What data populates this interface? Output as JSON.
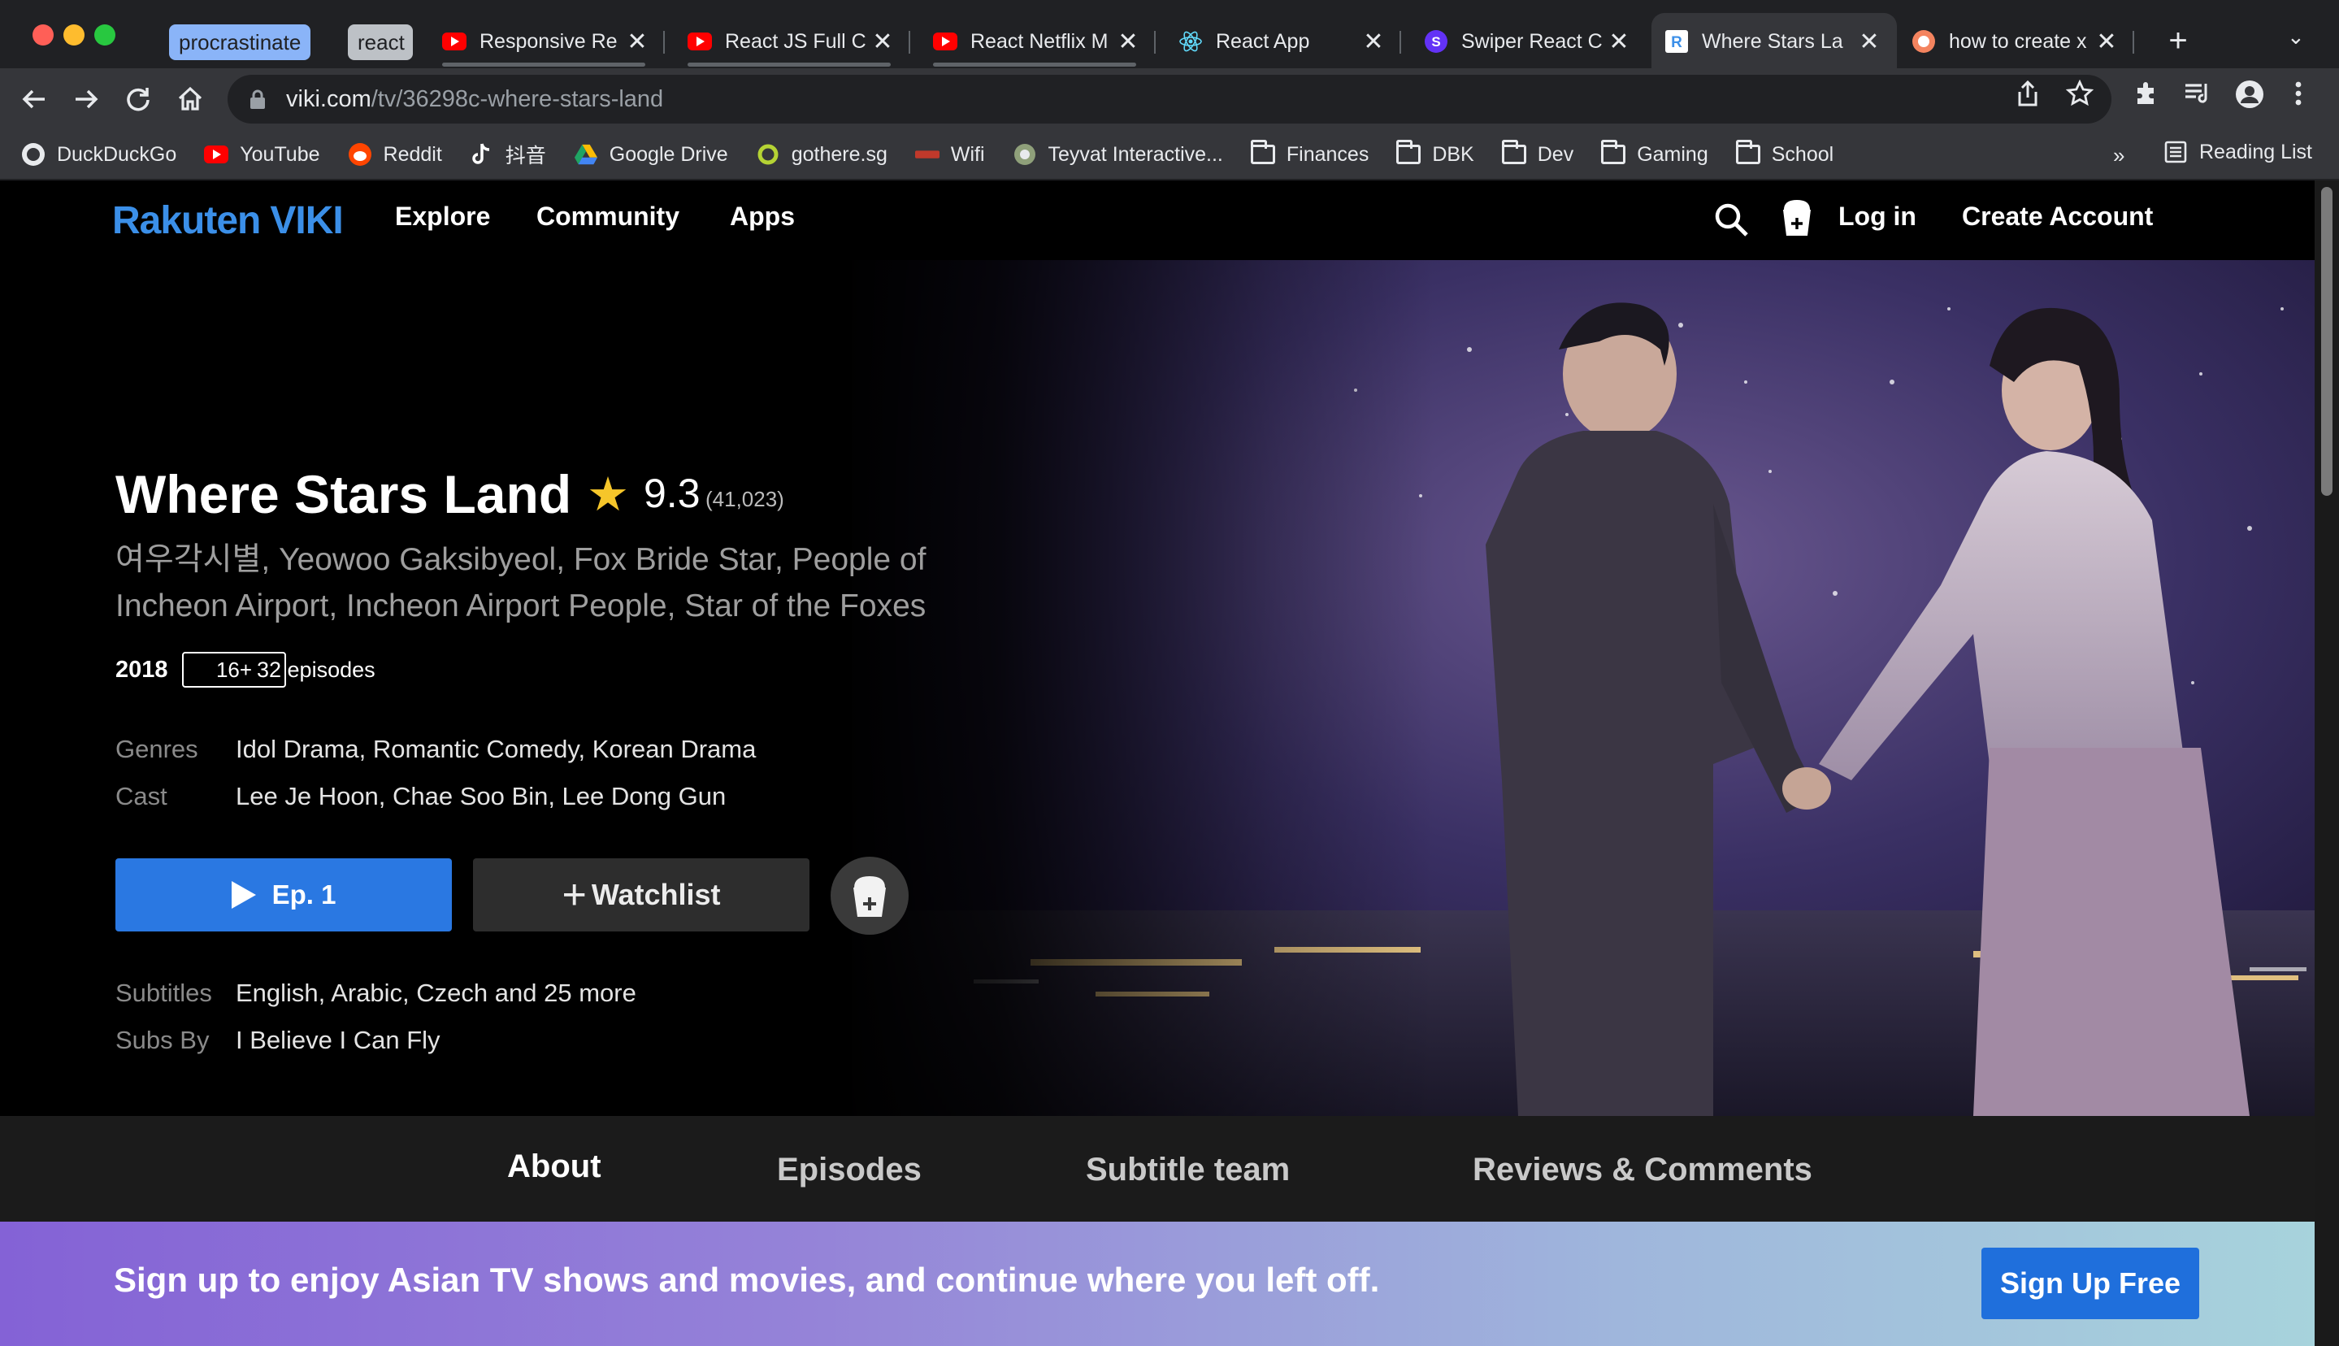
{
  "browser": {
    "tab_groups": [
      {
        "label": "procrastinate",
        "color": "#8ab4f8"
      },
      {
        "label": "react",
        "color": "#bdc1c6"
      }
    ],
    "tabs": [
      {
        "title": "Responsive Re",
        "favicon": "youtube-icon"
      },
      {
        "title": "React JS Full C",
        "favicon": "youtube-icon"
      },
      {
        "title": "React Netflix M",
        "favicon": "youtube-icon"
      },
      {
        "title": "React App",
        "favicon": "react-icon"
      },
      {
        "title": "Swiper React C",
        "favicon": "swiper-icon"
      },
      {
        "title": "Where Stars La",
        "favicon": "rakuten-icon",
        "active": true
      },
      {
        "title": "how to create x",
        "favicon": "generic-icon"
      }
    ],
    "address": {
      "host": "viki.com",
      "path": "/tv/36298c-where-stars-land"
    },
    "bookmarks": [
      {
        "label": "DuckDuckGo",
        "icon": "duckduckgo-icon"
      },
      {
        "label": "YouTube",
        "icon": "youtube-icon"
      },
      {
        "label": "Reddit",
        "icon": "reddit-icon"
      },
      {
        "label": "抖音",
        "icon": "tiktok-icon"
      },
      {
        "label": "Google Drive",
        "icon": "google-drive-icon"
      },
      {
        "label": "gothere.sg",
        "icon": "gothere-icon"
      },
      {
        "label": "Wifi",
        "icon": "wifi-site-icon"
      },
      {
        "label": "Teyvat Interactive...",
        "icon": "teyvat-icon"
      },
      {
        "label": "Finances",
        "icon": "folder-icon"
      },
      {
        "label": "DBK",
        "icon": "folder-icon"
      },
      {
        "label": "Dev",
        "icon": "folder-icon"
      },
      {
        "label": "Gaming",
        "icon": "folder-icon"
      },
      {
        "label": "School",
        "icon": "folder-icon"
      }
    ],
    "bookmarks_overflow": "»",
    "reading_list": "Reading List"
  },
  "site": {
    "logo_rakuten": "Rakuten",
    "logo_viki": "VIKI",
    "nav": [
      "Explore",
      "Community",
      "Apps"
    ],
    "login": "Log in",
    "create_account": "Create Account"
  },
  "show": {
    "title": "Where Stars Land",
    "rating": "9.3",
    "rating_count": "(41,023)",
    "alt_titles": "여우각시별, Yeowoo Gaksibyeol, Fox Bride Star, People of Incheon Airport, Incheon Airport People, Star of the Foxes",
    "year": "2018",
    "age_rating": "16+",
    "episodes": "32 episodes",
    "genres_label": "Genres",
    "genres": "Idol Drama, Romantic Comedy, Korean Drama",
    "cast_label": "Cast",
    "cast": "Lee Je Hoon, Chae Soo Bin, Lee Dong Gun",
    "play_label": "Ep. 1",
    "watchlist_label": "Watchlist",
    "subtitles_label": "Subtitles",
    "subtitles": "English, Arabic, Czech and 25 more",
    "subs_by_label": "Subs By",
    "subs_by": "I Believe I Can Fly"
  },
  "page_tabs": [
    "About",
    "Episodes",
    "Subtitle team",
    "Reviews & Comments"
  ],
  "banner": {
    "text": "Sign up to enjoy Asian TV shows and movies, and continue where you left off.",
    "button": "Sign Up Free"
  },
  "colors": {
    "viki_blue": "#3b8fe8",
    "play_button": "#2a78e2",
    "star": "#f6c62a"
  }
}
